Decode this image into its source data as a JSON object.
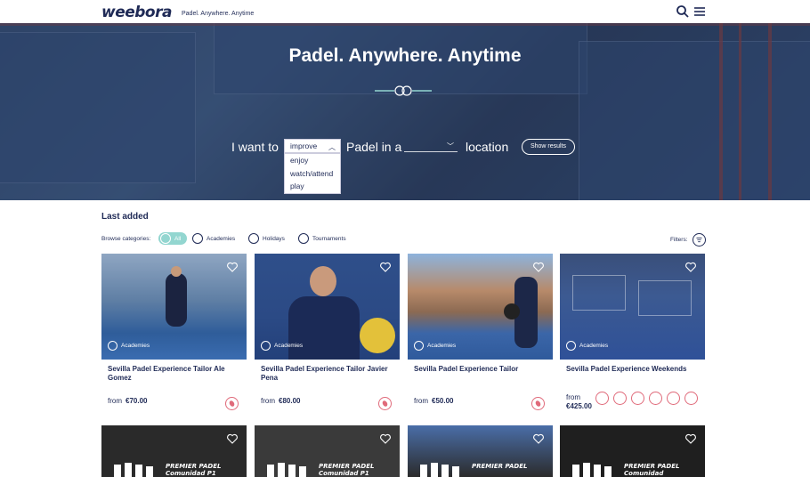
{
  "header": {
    "logo": "weebora",
    "tagline": "Padel. Anywhere. Anytime",
    "search_icon": "search-icon",
    "menu_icon": "menu-icon"
  },
  "hero": {
    "title": "Padel. Anywhere. Anytime",
    "i_want_to": "I want to",
    "selected_option": "improve",
    "options": [
      "enjoy",
      "watch/attend",
      "play"
    ],
    "padel_in_a": "Padel in a",
    "location_value": "",
    "location_label": "location",
    "show_results": "Show results"
  },
  "listing": {
    "section_title": "Last added",
    "browse_label": "Browse categories:",
    "categories": [
      "All",
      "Academies",
      "Holidays",
      "Tournaments"
    ],
    "filters_label": "Filters:",
    "cards": [
      {
        "badge": "Academies",
        "title": "Sevilla Padel Experience Tailor Ale Gomez",
        "from": "from",
        "price": "€70.00"
      },
      {
        "badge": "Academies",
        "title": "Sevilla Padel Experience Tailor Javier Pena",
        "from": "from",
        "price": "€80.00"
      },
      {
        "badge": "Academies",
        "title": "Sevilla Padel Experience Tailor",
        "from": "from",
        "price": "€50.00"
      },
      {
        "badge": "Academies",
        "title": "Sevilla Padel Experience Weekends",
        "from": "from",
        "price": "€425.00"
      }
    ],
    "promo_text_line1": "PREMIER PADEL",
    "promo_text_line2": "Comunidad",
    "promo_text_line3": "P1"
  },
  "colors": {
    "brand": "#1f2a56",
    "accent_teal": "#93d6d0",
    "accent_pink": "#e06a7a"
  }
}
